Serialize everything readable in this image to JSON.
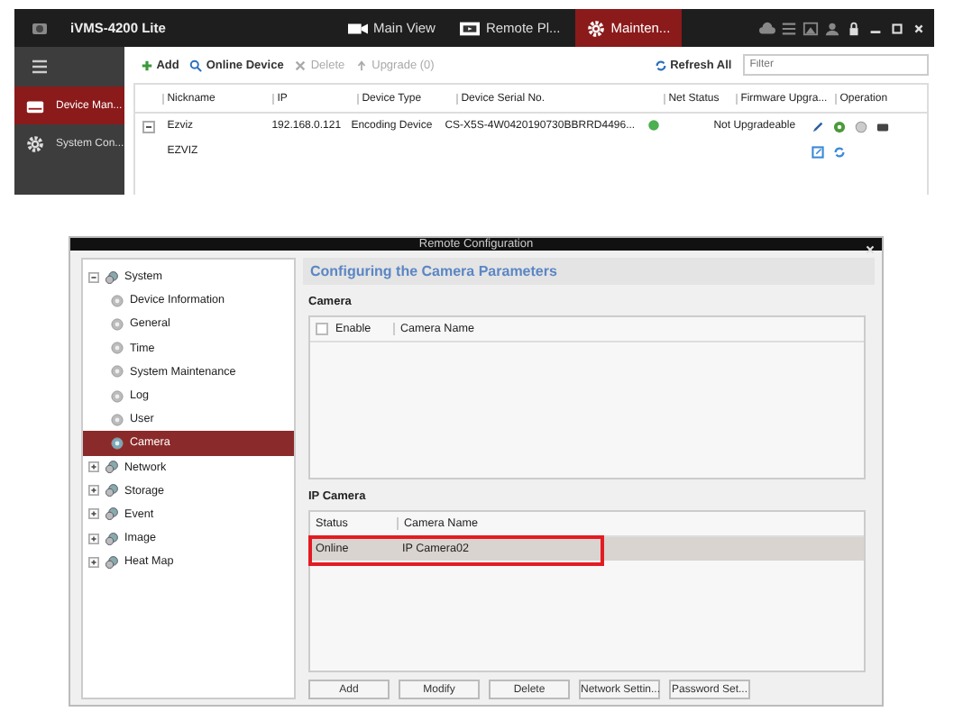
{
  "client": {
    "title": "iVMS-4200 Lite",
    "nav_tabs": [
      {
        "label": "Main View",
        "selected": false
      },
      {
        "label": "Remote Pl...",
        "selected": false
      },
      {
        "label": "Mainten...",
        "selected": true
      }
    ],
    "sidebar": [
      {
        "label": "Device Man...",
        "selected": true
      },
      {
        "label": "System Con...",
        "selected": false
      }
    ],
    "toolbar": [
      {
        "label": "Add",
        "disabled": false
      },
      {
        "label": "Online Device",
        "disabled": false
      },
      {
        "label": "Delete",
        "disabled": true
      },
      {
        "label": "Upgrade (0)",
        "disabled": true
      }
    ],
    "refresh": "Refresh All",
    "filter": {
      "placeholder": "Filter"
    },
    "columns": [
      "Nickname",
      "IP",
      "Device Type",
      "Device Serial No.",
      "Net Status",
      "Firmware Upgra...",
      "Operation"
    ],
    "rows": [
      {
        "expanded": true,
        "nickname": "Ezviz",
        "ip": "192.168.0.121",
        "type": "Encoding Device",
        "serial": "CS-X5S-4W0420190730BBRRD4496...",
        "online": true,
        "firmware": "Not Upgradeable",
        "sub": "EZVIZ"
      }
    ]
  },
  "dialog": {
    "title": "Remote Configuration",
    "tree": [
      {
        "label": "System",
        "expanded": true,
        "children": [
          {
            "label": "Device Information",
            "selected": false
          },
          {
            "label": "General",
            "selected": false
          },
          {
            "label": "Time",
            "selected": false
          },
          {
            "label": "System Maintenance",
            "selected": false
          },
          {
            "label": "Log",
            "selected": false
          },
          {
            "label": "User",
            "selected": false
          },
          {
            "label": "Camera",
            "selected": true
          }
        ]
      },
      {
        "label": "Network",
        "expanded": false
      },
      {
        "label": "Storage",
        "expanded": false
      },
      {
        "label": "Event",
        "expanded": false
      },
      {
        "label": "Image",
        "expanded": false
      },
      {
        "label": "Heat Map",
        "expanded": false
      }
    ],
    "heading": "Configuring the Camera Parameters",
    "camera": {
      "title": "Camera",
      "enable": {
        "label": "Enable",
        "checked": false
      },
      "columns": [
        "Camera Name"
      ]
    },
    "ip_camera": {
      "title": "IP Camera",
      "columns": [
        "Status",
        "Camera Name"
      ],
      "rows": [
        {
          "status": "Online",
          "name": "IP Camera02",
          "selected": true,
          "highlighted": true
        }
      ]
    },
    "buttons": [
      "Add",
      "Modify",
      "Delete",
      "Network Settin...",
      "Password Set..."
    ]
  }
}
